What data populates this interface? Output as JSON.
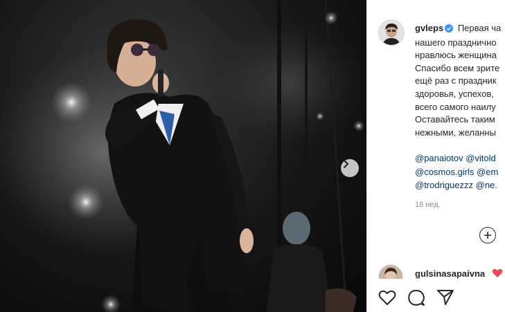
{
  "post": {
    "photo_alt": "singer-on-stage",
    "next_icon": "chevron-right-icon"
  },
  "author": {
    "username": "gvleps",
    "verified": true,
    "caption_lines": [
      "Первая ча",
      "нашего празднично",
      "нравлюсь женщина",
      "Спасибо всем зрите",
      "ещё раз с праздник",
      "здоровья, успехов, ",
      "всего самого наилу",
      "Оставайтесь таким",
      "нежными, желанны"
    ],
    "mention_lines": [
      "@panaiotov @vitold",
      "@cosmos.girls @em",
      "@trodriguezzz @ne."
    ],
    "time": "18 нед."
  },
  "comment": {
    "username": "gulsinasapaivna",
    "emoji_icon": "red-heart-icon"
  },
  "icons": {
    "add": "plus-circle-icon",
    "like": "heart-icon",
    "comment": "comment-icon",
    "share": "share-icon"
  },
  "colors": {
    "verified": "#3897f0",
    "link": "#00376b",
    "meta": "#8e8e8e",
    "heart": "#ed4956"
  }
}
